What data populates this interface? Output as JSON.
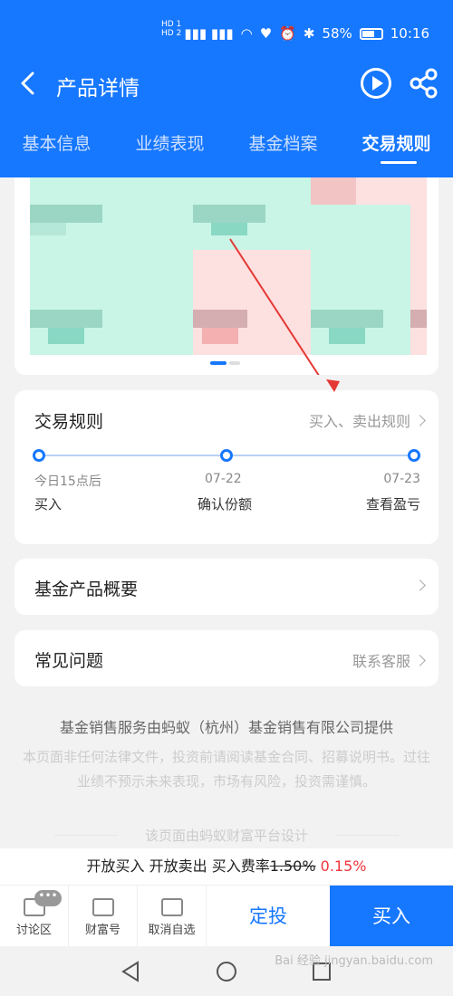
{
  "statusbar": {
    "net_left": "HD 1\nHD 2",
    "battery": "58%",
    "time": "10:16"
  },
  "header": {
    "title": "产品详情",
    "tabs": [
      {
        "label": "基本信息"
      },
      {
        "label": "业绩表现"
      },
      {
        "label": "基金档案"
      },
      {
        "label": "交易规则"
      }
    ],
    "active_tab": 3
  },
  "rules": {
    "title": "交易规则",
    "link": "买入、卖出规则",
    "steps": [
      {
        "top": "今日15点后",
        "bottom": "买入"
      },
      {
        "top": "07-22",
        "bottom": "确认份额"
      },
      {
        "top": "07-23",
        "bottom": "查看盈亏"
      }
    ]
  },
  "overview": {
    "label": "基金产品概要"
  },
  "faq": {
    "label": "常见问题",
    "link": "联系客服"
  },
  "footer": {
    "main": "基金销售服务由蚂蚁（杭州）基金销售有限公司提供",
    "disclaimer": "本页面非任何法律文件，投资前请阅读基金合同、招募说明书。过往业绩不预示未来表现，市场有风险，投资需谨慎。",
    "design": "该页面由蚂蚁财富平台设计"
  },
  "rate_bar": {
    "prefix": "开放买入 开放卖出  买入费率",
    "old_rate": "1.50%",
    "new_rate": "0.15%"
  },
  "bottom": {
    "items": [
      {
        "label": "讨论区",
        "icon": "chat-icon"
      },
      {
        "label": "财富号",
        "icon": "store-icon"
      },
      {
        "label": "取消自选",
        "icon": "remove-watchlist-icon"
      }
    ],
    "badge": "•••",
    "dingtou": "定投",
    "buy": "买入"
  },
  "watermark": "Bai 经验 jingyan.baidu.com",
  "colors": {
    "brand": "#1677ff",
    "danger": "#f0353c"
  }
}
